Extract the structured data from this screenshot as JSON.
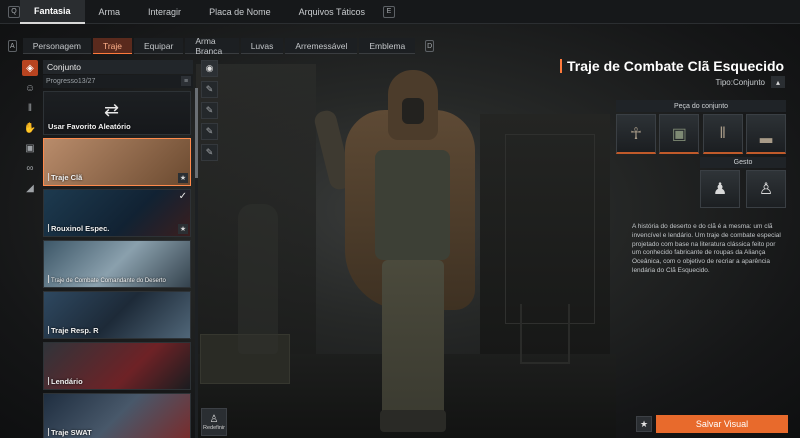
{
  "top_tabs": {
    "key_left": "Q",
    "items": [
      {
        "label": "Fantasia",
        "active": true
      },
      {
        "label": "Arma"
      },
      {
        "label": "Interagir"
      },
      {
        "label": "Placa de Nome"
      },
      {
        "label": "Arquivos Táticos"
      }
    ],
    "key_right": "E"
  },
  "sub_tabs": {
    "key_left": "A",
    "items": [
      {
        "label": "Personagem"
      },
      {
        "label": "Traje",
        "active": true
      },
      {
        "label": "Equipar"
      },
      {
        "label": "Arma Branca"
      },
      {
        "label": "Luvas"
      },
      {
        "label": "Arremessável"
      },
      {
        "label": "Emblema"
      }
    ],
    "key_right": "D"
  },
  "left_rail_icons": [
    "outfit-icon",
    "character-icon",
    "pants-icon",
    "gloves-icon",
    "backpack-icon",
    "glasses-icon",
    "cap-icon"
  ],
  "list": {
    "header": "Conjunto",
    "progress": "Progresso13/27",
    "sort_icon": "sort-icon",
    "items": [
      {
        "name": "Usar Favorito Aleatório",
        "type": "random"
      },
      {
        "name": "Traje Clã",
        "selected": true,
        "favorite": true
      },
      {
        "name": "Rouxinol Espec.",
        "equipped": true,
        "favorite": true
      },
      {
        "name": "Traje de Combate Comandante do Deserto"
      },
      {
        "name": "Traje Resp. R"
      },
      {
        "name": "Lendário"
      },
      {
        "name": "Traje SWAT"
      }
    ]
  },
  "mini_rail": {
    "icons": [
      "camera-icon",
      "pose-1-icon",
      "pose-2-icon",
      "pose-3-icon",
      "pose-4-icon"
    ],
    "reset_label": "Redefinir"
  },
  "detail": {
    "title": "Traje de Combate Clã Esquecido",
    "type_label": "Tipo:Conjunto",
    "parts_header": "Peça do conjunto",
    "parts": [
      "hood-icon",
      "jacket-icon",
      "pants-icon",
      "boots-icon"
    ],
    "gesture_header": "Gesto",
    "gestures": [
      "gesture-1-icon",
      "gesture-2-icon"
    ],
    "description": "A história do deserto e do clã é a mesma: um clã invencível e lendário. Um traje de combate especial projetado com base na literatura clássica feito por um conhecido fabricante de roupas da Aliança Oceânica, com o objetivo de recriar a aparência lendária do Clã Esquecido.",
    "save_label": "Salvar Visual"
  },
  "colors": {
    "accent": "#e86a2c",
    "active_tab": "#5a2a1d"
  }
}
